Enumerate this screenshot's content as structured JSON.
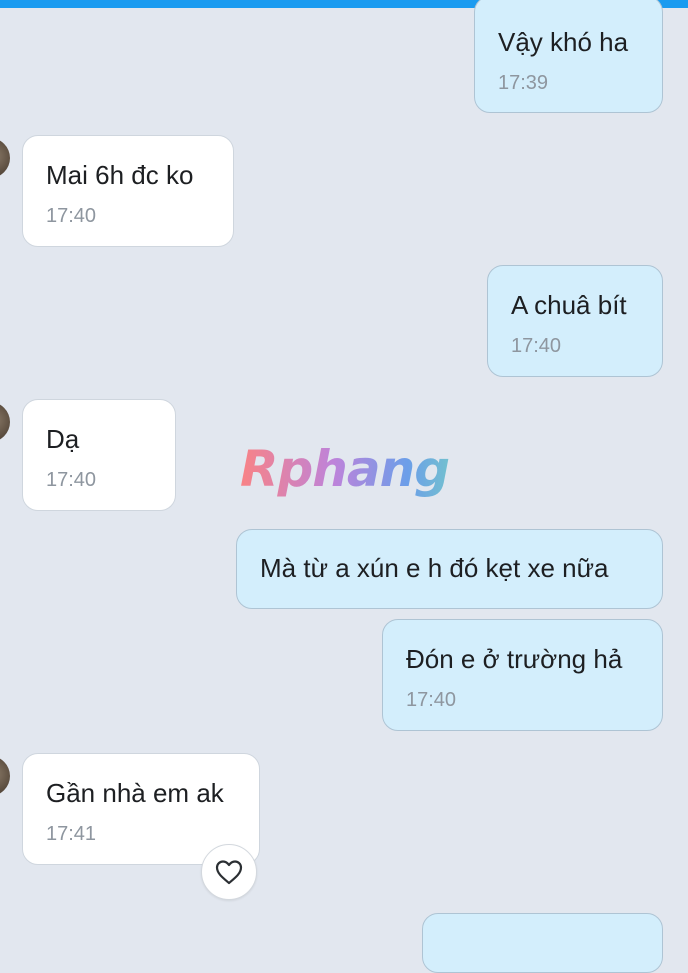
{
  "watermark": "Rphang",
  "messages": [
    {
      "side": "out",
      "text": "Vậy khó ha",
      "time": "17:39"
    },
    {
      "side": "in",
      "text": "Mai 6h đc ko",
      "time": "17:40"
    },
    {
      "side": "out",
      "text": "A chuâ bít",
      "time": "17:40"
    },
    {
      "side": "in",
      "text": "Dạ",
      "time": "17:40"
    },
    {
      "side": "out",
      "text": "Mà từ a xún e h đó kẹt xe nữa",
      "time": ""
    },
    {
      "side": "out",
      "text": "Đón e ở trường hả",
      "time": "17:40"
    },
    {
      "side": "in",
      "text": "Gần nhà em ak",
      "time": "17:41"
    }
  ],
  "icons": {
    "reaction": "heart-icon",
    "avatar": "avatar"
  },
  "colors": {
    "accent": "#1a9bf0",
    "outgoing": "#d3eefc",
    "incoming": "#ffffff",
    "background": "#e2e7ef"
  }
}
